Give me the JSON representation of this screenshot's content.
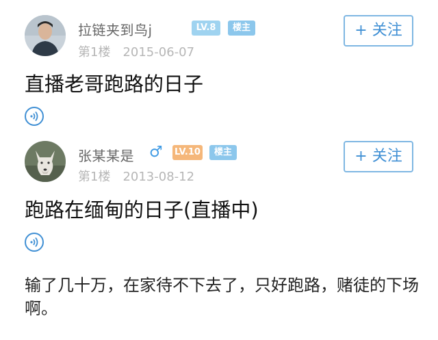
{
  "posts": [
    {
      "username": "拉链夹到鸟j",
      "level": "LV.8",
      "host_badge": "楼主",
      "floor": "第1楼",
      "date": "2015-06-07",
      "follow_label": "+ 关注",
      "title": "直播老哥跑路的日子",
      "avatar_icon": "person-photo-avatar",
      "voice_icon": "voice-play-icon"
    },
    {
      "username": "张某某是",
      "gender_icon": "male-symbol-icon",
      "gender_glyph": "♂",
      "level": "LV.10",
      "host_badge": "楼主",
      "floor": "第1楼",
      "date": "2013-08-12",
      "follow_label": "+ 关注",
      "title": "跑路在缅甸的日子(直播中)",
      "avatar_icon": "wolf-photo-avatar",
      "voice_icon": "voice-play-icon",
      "body": "输了几十万，在家待不下去了，只好跑路，赌徒的下场啊。"
    }
  ],
  "colors": {
    "accent": "#3f8fd4",
    "level_blue": "#9fd3f0",
    "level_orange": "#f5b77a",
    "meta_gray": "#b6b6b6"
  }
}
